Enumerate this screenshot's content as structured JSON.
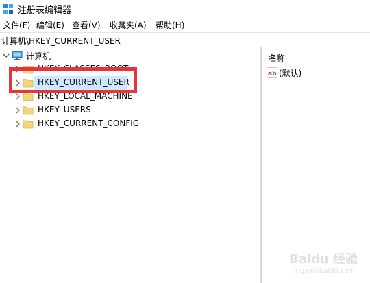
{
  "window": {
    "title": "注册表编辑器",
    "app_icon": "regedit-icon"
  },
  "menu": [
    {
      "label": "文件(F)"
    },
    {
      "label": "编辑(E)"
    },
    {
      "label": "查看(V)"
    },
    {
      "label": "收藏夹(A)"
    },
    {
      "label": "帮助(H)"
    }
  ],
  "address": {
    "path": "计算机\\HKEY_CURRENT_USER"
  },
  "tree": {
    "root": {
      "label": "计算机",
      "icon": "computer-icon",
      "expanded": true
    },
    "keys": [
      {
        "label": "HKEY_CLASSES_ROOT",
        "icon": "folder-icon"
      },
      {
        "label": "HKEY_CURRENT_USER",
        "icon": "folder-icon",
        "selected": true
      },
      {
        "label": "HKEY_LOCAL_MACHINE",
        "icon": "folder-icon"
      },
      {
        "label": "HKEY_USERS",
        "icon": "folder-icon"
      },
      {
        "label": "HKEY_CURRENT_CONFIG",
        "icon": "folder-icon"
      }
    ]
  },
  "values_pane": {
    "column_name": "名称",
    "rows": [
      {
        "name": "(默认)",
        "icon": "string-value-icon"
      }
    ]
  },
  "watermark": {
    "text": "Baidu 经验",
    "sub": "jingyan.baidu.com"
  },
  "colors": {
    "highlight_border": "#e7343a",
    "selection": "#cde8ff",
    "folder": "#f3d57b"
  }
}
